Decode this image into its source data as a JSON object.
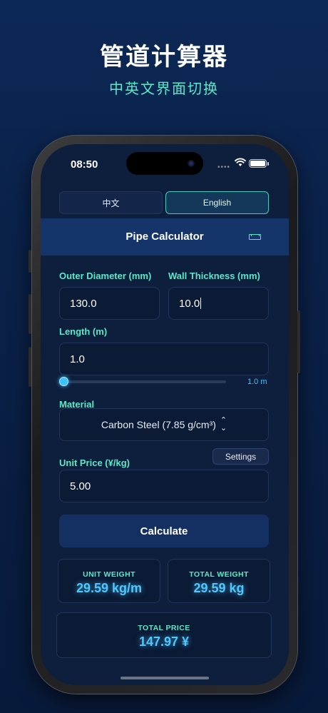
{
  "promo": {
    "title": "管道计算器",
    "subtitle": "中英文界面切换"
  },
  "status_bar": {
    "time": "08:50"
  },
  "language_switch": {
    "chinese_label": "中文",
    "english_label": "English",
    "selected": "English"
  },
  "header": {
    "title": "Pipe Calculator",
    "icon": "ruler-icon"
  },
  "form": {
    "outer_diameter": {
      "label": "Outer Diameter (mm)",
      "value": "130.0"
    },
    "wall_thickness": {
      "label": "Wall Thickness (mm)",
      "value": "10.0"
    },
    "length": {
      "label": "Length (m)",
      "value": "1.0",
      "slider_value_text": "1.0 m",
      "slider_fraction": 0.0
    },
    "material": {
      "label": "Material",
      "selected": "Carbon Steel (7.85 g/cm³)"
    },
    "unit_price": {
      "label": "Unit Price (¥/kg)",
      "value": "5.00",
      "settings_label": "Settings"
    }
  },
  "calculate_label": "Calculate",
  "results": {
    "unit_weight": {
      "label": "UNIT WEIGHT",
      "value": "29.59 kg/m"
    },
    "total_weight": {
      "label": "TOTAL WEIGHT",
      "value": "29.59 kg"
    },
    "total_price": {
      "label": "TOTAL PRICE",
      "value": "147.97 ¥"
    }
  },
  "colors": {
    "accent_teal": "#5be8c8",
    "accent_blue": "#4ec8ff",
    "header_bg": "#15356a",
    "screen_bg": "#0e1e3d"
  }
}
